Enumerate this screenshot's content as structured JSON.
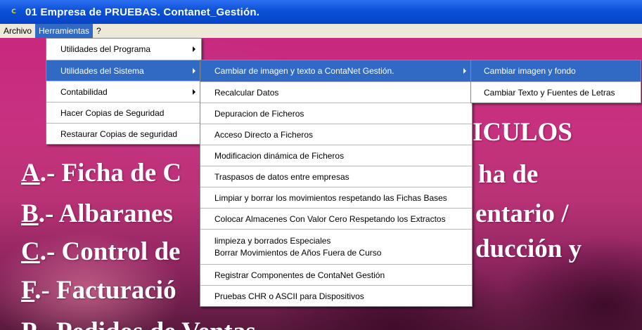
{
  "window": {
    "icon_text": "C",
    "title": "01  Empresa de PRUEBAS. Contanet_Gestión."
  },
  "menubar": {
    "items": [
      "Archivo",
      "Herramientas",
      "?"
    ]
  },
  "background_lines": [
    {
      "key": "A",
      "text": ".- Ficha de C",
      "right": "ha de"
    },
    {
      "key": "B",
      "text": ".- Albaranes",
      "right": "entario /"
    },
    {
      "key": "C",
      "text": ".- Control de",
      "right": "ducción y"
    },
    {
      "key": "F",
      "text": ".- Facturació",
      "right": ""
    },
    {
      "key": "P",
      "text": ".- Pedidos de Ventas",
      "right": ""
    }
  ],
  "background_heading_right": "ICULOS",
  "herramientas_menu": {
    "items": [
      {
        "label": "Utilidades del Programa"
      },
      {
        "label": "Utilidades del Sistema"
      },
      {
        "label": "Contabilidad"
      },
      {
        "label": "Hacer Copias de Seguridad"
      },
      {
        "label": "Restaurar Copias de seguridad"
      }
    ]
  },
  "sistema_menu": {
    "items": [
      {
        "label": "Cambiar de imagen y texto a ContaNet Gestión."
      },
      {
        "label": "Recalcular Datos"
      },
      {
        "label": "Depuracion de Ficheros"
      },
      {
        "label": "Acceso Directo a Ficheros"
      },
      {
        "label": "Modificacion dinámica de Ficheros"
      },
      {
        "label": "Traspasos de datos entre empresas"
      },
      {
        "label": "Limpiar  y borrar los movimientos respetando las Fichas Bases"
      },
      {
        "label": "Colocar Almacenes Con Valor Cero Respetando los Extractos"
      },
      {
        "label": "limpieza y borrados Especiales",
        "label2": "Borrar Movimientos de Años Fuera de Curso"
      },
      {
        "label": "Registrar Componentes de ContaNet Gestión"
      },
      {
        "label": "Pruebas CHR o ASCII para Dispositivos"
      }
    ]
  },
  "imagen_menu": {
    "items": [
      {
        "label": "Cambiar imagen y fondo"
      },
      {
        "label": "Cambiar Texto y Fuentes de Letras"
      }
    ]
  },
  "colors": {
    "titlebar": "#0a51d8",
    "selection": "#316ac5",
    "menubar": "#ece9d8"
  }
}
